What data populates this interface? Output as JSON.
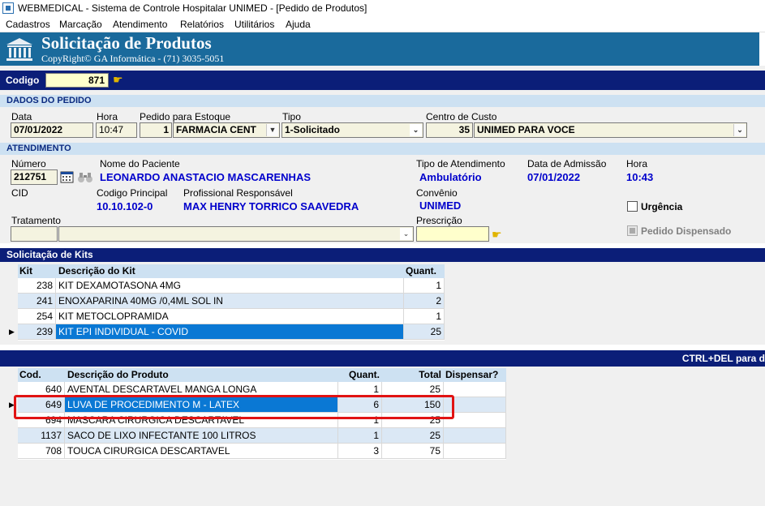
{
  "window": {
    "title": "WEBMEDICAL - Sistema de Controle Hospitalar UNIMED - [Pedido de Produtos]"
  },
  "menu": [
    "Cadastros",
    "Marcação",
    "Atendimento",
    "Relatórios",
    "Utilitários",
    "Ajuda"
  ],
  "header": {
    "title": "Solicitação de Produtos",
    "subtitle": "CopyRight© GA Informática - (71) 3035-5051",
    "logo_icon": "building-icon"
  },
  "codigo": {
    "label": "Codigo",
    "value": "871",
    "icon": "pointing-hand-icon"
  },
  "pedido": {
    "section_title": "DADOS DO PEDIDO",
    "data_label": "Data",
    "data_value": "07/01/2022",
    "hora_label": "Hora",
    "hora_value": "10:47",
    "estoque_label": "Pedido para Estoque",
    "estoque_code": "1",
    "estoque_value": "FARMACIA CENT",
    "tipo_label": "Tipo",
    "tipo_value": "1-Solicitado",
    "centro_label": "Centro de Custo",
    "centro_code": "35",
    "centro_value": "UNIMED PARA VOCE"
  },
  "atendimento": {
    "section_title": "ATENDIMENTO",
    "numero_label": "Número",
    "numero_value": "212751",
    "paciente_label": "Nome do Paciente",
    "paciente_value": "LEONARDO ANASTACIO MASCARENHAS",
    "tipo_atend_label": "Tipo de Atendimento",
    "tipo_atend_value": "Ambulatório",
    "admissao_label": "Data de Admissão",
    "admissao_value": "07/01/2022",
    "hora_label": "Hora",
    "hora_value": "10:43",
    "cid_label": "CID",
    "codigo_principal_label": "Codigo Principal",
    "codigo_principal_value": "10.10.102-0",
    "profissional_label": "Profissional Responsável",
    "profissional_value": "MAX HENRY TORRICO SAAVEDRA",
    "convenio_label": "Convênio",
    "convenio_value": "UNIMED",
    "urgencia_label": "Urgência",
    "dispensado_label": "Pedido Dispensado",
    "tratamento_label": "Tratamento",
    "prescricao_label": "Prescrição"
  },
  "kits": {
    "title": "Solicitação de Kits",
    "headers": [
      "Kit",
      "Descrição do Kit",
      "Quant."
    ],
    "rows": [
      {
        "kit": "238",
        "desc": "KIT DEXAMOTASONA 4MG",
        "qty": "1"
      },
      {
        "kit": "241",
        "desc": "ENOXAPARINA 40MG /0,4ML SOL IN",
        "qty": "2"
      },
      {
        "kit": "254",
        "desc": "KIT METOCLOPRAMIDA",
        "qty": "1"
      },
      {
        "kit": "239",
        "desc": "KIT EPI INDIVIDUAL - COVID",
        "qty": "25"
      }
    ]
  },
  "produtos": {
    "bar_text": "CTRL+DEL para d",
    "headers": [
      "Cod.",
      "Descrição do Produto",
      "Quant.",
      "Total",
      "Dispensar?"
    ],
    "rows": [
      {
        "cod": "640",
        "desc": "AVENTAL DESCARTAVEL MANGA LONGA",
        "qty": "1",
        "total": "25"
      },
      {
        "cod": "649",
        "desc": "LUVA DE PROCEDIMENTO M - LATEX",
        "qty": "6",
        "total": "150"
      },
      {
        "cod": "694",
        "desc": "MASCARA CIRURGICA DESCARTAVEL",
        "qty": "1",
        "total": "25"
      },
      {
        "cod": "1137",
        "desc": "SACO DE LIXO INFECTANTE 100 LITROS",
        "qty": "1",
        "total": "25"
      },
      {
        "cod": "708",
        "desc": "TOUCA CIRURGICA DESCARTAVEL",
        "qty": "3",
        "total": "75"
      }
    ]
  },
  "colors": {
    "banner": "#1a6a9c",
    "navy_bar": "#0b1e78",
    "section": "#cde1f2",
    "selection": "#0a78d4",
    "highlight_box": "#e11313"
  }
}
